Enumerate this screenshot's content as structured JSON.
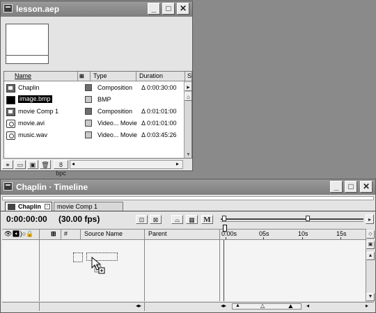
{
  "project_window": {
    "title": "lesson.aep",
    "controls": [
      "_",
      "□",
      "✕"
    ],
    "columns": [
      "Name",
      "Type",
      "Duration",
      "S"
    ],
    "items": [
      {
        "name": "Chaplin",
        "icon": "composition-icon",
        "color": "#6e6e6e",
        "type": "Composition",
        "duration": "Δ 0:00:30:00",
        "selected": false
      },
      {
        "name": "image.bmp",
        "icon": "image-file-icon",
        "color": "#c8c8c8",
        "type": "BMP",
        "duration": "",
        "selected": true
      },
      {
        "name": "movie Comp 1",
        "icon": "composition-icon",
        "color": "#6e6e6e",
        "type": "Composition",
        "duration": "Δ 0:01:01:00",
        "selected": false
      },
      {
        "name": "movie.avi",
        "icon": "movie-file-icon",
        "color": "#c8c8c8",
        "type": "Video... Movie",
        "duration": "Δ 0:01:01:00",
        "selected": false
      },
      {
        "name": "music.wav",
        "icon": "audio-file-icon",
        "color": "#c8c8c8",
        "type": "Video... Movie",
        "duration": "Δ 0:03:45:26",
        "selected": false
      }
    ],
    "bit_depth": "8 bpc"
  },
  "timeline_window": {
    "title": "Chaplin · Timeline",
    "controls": [
      "_",
      "□",
      "✕"
    ],
    "tabs": [
      {
        "label": "Chaplin",
        "active": true
      },
      {
        "label": "movie Comp 1",
        "active": false
      }
    ],
    "timecode": "0:00:00:00",
    "fps": "(30.00 fps)",
    "motion_blur_label": "M",
    "columns": {
      "number": "#",
      "source_name": "Source Name",
      "parent": "Parent"
    },
    "ruler_ticks": [
      "0:00s",
      "05s",
      "10s",
      "15s"
    ]
  }
}
